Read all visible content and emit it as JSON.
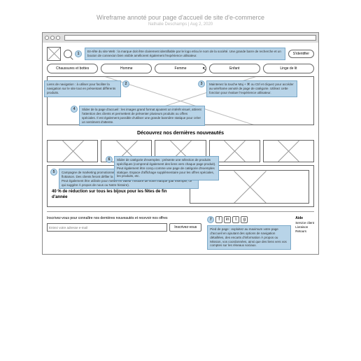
{
  "title": "Wireframe annoté pour page d'accueil de site d'e-commerce",
  "subtitle": "Nathalie Deschamps | Aug 2, 2020",
  "header": {
    "login_label": "S'identifier"
  },
  "nav": {
    "items": [
      "Chaussures et bottes",
      "Homme",
      "Femme",
      "Enfant",
      "Linge de lit"
    ]
  },
  "annotations": {
    "n1": "En-tête du site Web : la marque doit être clairement identifiable par le logo et/ou le nom de la société. Une grande barre de recherche et un bouton de connexion bien visible améliorent également l'expérience utilisateur.",
    "n2": "Liens de navigation : à utiliser pour faciliter la navigation sur le site tout en présentant différents produits.",
    "n3": "Maintenez la touche Maj + ⌘ ou Ctrl et cliquez pour accéder au wireframe annoté de page de catégorie. Utilisez cette fonction pour évaluer l'expérience utilisateur.",
    "n4": "Slider de la page d'accueil : les images grand format ajoutent un intérêt visuel, attirent l'attention des clients et permettent de présenter plusieurs produits ou offres spéciales. Il est également possible d'utiliser une grande bannière statique pour créer un sentiment d'attente.",
    "n5": "Campagne de marketing promotionnel : bannière plus volumineuse située sous la ligne de flottaison. Des clients feront défiler la page vers le bas pour la voir pour les offres spéciales. Peut également être utilisée pour mettre en valeur l'histoire de votre marque (par exemple, ce qui suggère À propos de nous ou Notre histoire).",
    "n6": "Slider de catégorie d'exemples : présente une sélection de produits spécifiques (comprend également des liens vers chaque page produit). Peut également être conçu comme une page de catégorie d'exemples statique. Espace d'affichage supplémentaire pour les offres spéciales, les produits, etc.",
    "n7": "Pied de page : exploitez au maximum votre page d'accueil en ajoutant des options de navigation détaillées, des encarts d'information À propos ou Mission, vos coordonnées, ainsi que des liens vers vos comptes sur les réseaux sociaux."
  },
  "section_title": "Découvrez nos dernières nouveautés",
  "promo": {
    "headline": "40 % de réduction sur tous les bijoux pour les fêtes de fin d'année"
  },
  "footer": {
    "newsletter_text": "Inscrivez-vous pour connaître nos dernières nouveautés et recevoir nos offres",
    "email_placeholder": "Entrez votre adresse e-mail",
    "subscribe_label": "Inscrivez-vous",
    "aide_title": "Aide",
    "aide_items": [
      "Service client",
      "Livraison",
      "Retours"
    ]
  }
}
